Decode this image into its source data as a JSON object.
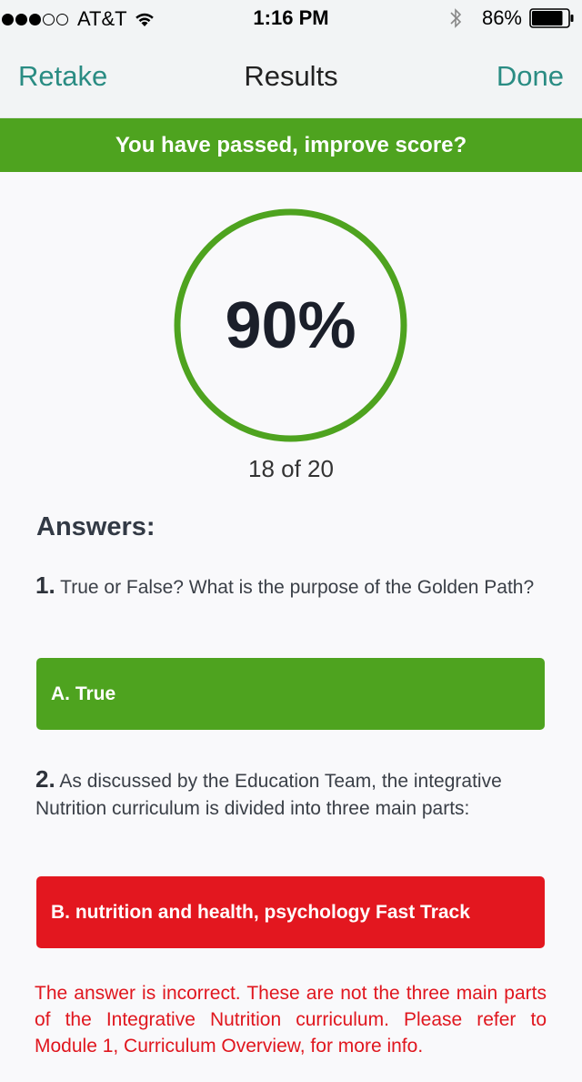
{
  "status_bar": {
    "carrier": "AT&T",
    "time": "1:16 PM",
    "battery_percent": "86%",
    "signal_bars_filled": 3,
    "signal_bars_total": 5,
    "battery_level": 0.86
  },
  "nav": {
    "left_label": "Retake",
    "title": "Results",
    "right_label": "Done"
  },
  "banner": {
    "text": "You have passed, improve score?",
    "color": "#4ea31f"
  },
  "score": {
    "percent_label": "90%",
    "percent_value": 0.9,
    "summary": "18 of 20",
    "ring_color": "#4ea31f"
  },
  "answers": {
    "heading": "Answers:",
    "items": [
      {
        "number": "1.",
        "question": "True or False? What is the purpose of the Golden Path?",
        "answer": "A. True",
        "status": "correct"
      },
      {
        "number": "2.",
        "question": "As discussed by the Education Team, the integrative Nutrition curriculum is divided into three main parts:",
        "answer": "B. nutrition and health, psychology Fast Track",
        "status": "incorrect",
        "feedback": "The answer is incorrect. These are not the three main parts of the Integrative Nutrition curriculum. Please refer to Module 1, Curriculum Overview, for more info."
      }
    ]
  },
  "colors": {
    "accent": "#2a8c83",
    "correct": "#4ea31f",
    "incorrect": "#e3171f"
  },
  "icons": [
    "wifi-icon",
    "bluetooth-icon",
    "battery-icon"
  ]
}
